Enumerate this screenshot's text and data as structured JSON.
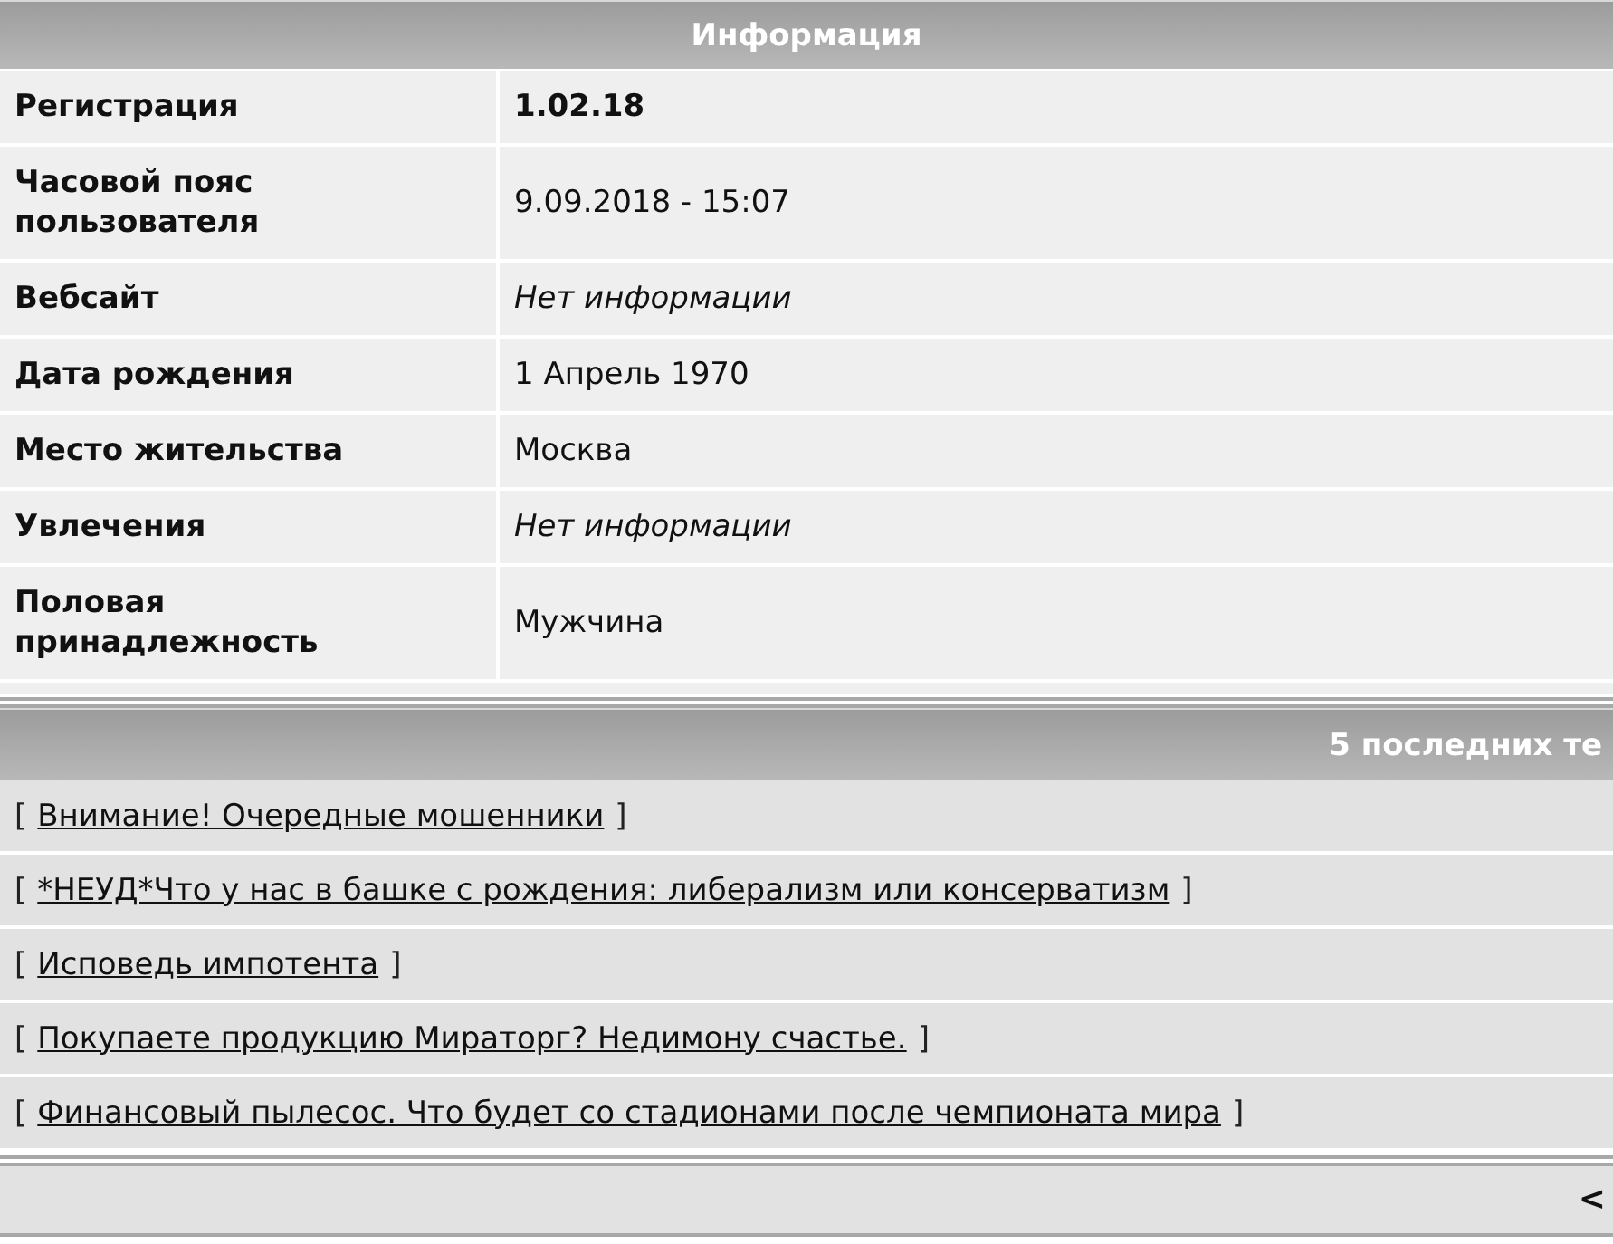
{
  "info_panel": {
    "title": "Информация",
    "rows": [
      {
        "label": "Регистрация",
        "value": "1.02.18",
        "kind": "bold"
      },
      {
        "label": "Часовой пояс пользователя",
        "value": "9.09.2018 - 15:07",
        "kind": "plain"
      },
      {
        "label": "Вебсайт",
        "value": "Нет информации",
        "kind": "italic"
      },
      {
        "label": "Дата рождения",
        "value": "1 Апрель 1970",
        "kind": "plain"
      },
      {
        "label": "Место жительства",
        "value": "Москва",
        "kind": "plain"
      },
      {
        "label": "Увлечения",
        "value": "Нет информации",
        "kind": "italic"
      },
      {
        "label": "Половая принадлежность",
        "value": "Мужчина",
        "kind": "plain"
      }
    ]
  },
  "recent_topics": {
    "title": "5 последних те",
    "topics": [
      {
        "open": "[",
        "link": "Внимание! Очередные мошенники",
        "close": "]"
      },
      {
        "open": "[",
        "link": "*НЕУД*Что у нас в башке с рождения: либерализм или консерватизм",
        "close": "]"
      },
      {
        "open": "[",
        "link": "Исповедь импотента",
        "close": "]"
      },
      {
        "open": "[",
        "link": "Покупаете продукцию Мираторг? Недимону счастье.",
        "close": "]"
      },
      {
        "open": "[",
        "link": "Финансовый пылесос. Что будет со стадионами после чемпионата мира",
        "close": "]"
      }
    ]
  },
  "footer": {
    "pager": "<"
  }
}
